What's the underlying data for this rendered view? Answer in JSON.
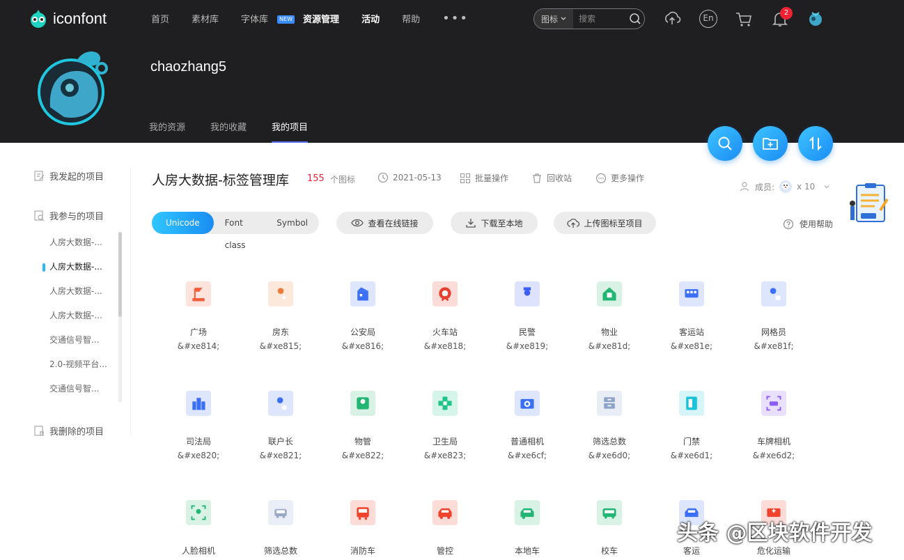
{
  "header": {
    "logo_text": "iconfont",
    "nav": [
      {
        "label": "首页",
        "bold": false
      },
      {
        "label": "素材库",
        "bold": false
      },
      {
        "label": "字体库",
        "bold": false,
        "badge": "NEW"
      },
      {
        "label": "资源管理",
        "bold": true
      },
      {
        "label": "活动",
        "bold": true
      },
      {
        "label": "帮助",
        "bold": false
      }
    ],
    "more": "•••",
    "search": {
      "scope": "图标",
      "placeholder": "搜索"
    },
    "icons": [
      "upload-icon",
      "language-en-icon",
      "cart-icon",
      "bell-icon",
      "user-avatar-icon"
    ],
    "lang_label": "En",
    "notification_count": "2"
  },
  "profile": {
    "username": "chaozhang5",
    "tabs": [
      {
        "label": "我的资源",
        "active": false
      },
      {
        "label": "我的收藏",
        "active": false
      },
      {
        "label": "我的项目",
        "active": true
      }
    ]
  },
  "sidebar": {
    "groups": [
      {
        "label": "我发起的项目",
        "icon": "edit-icon"
      },
      {
        "label": "我参与的项目",
        "icon": "search-doc-icon"
      },
      {
        "label": "我删除的项目",
        "icon": "trash-doc-icon"
      }
    ],
    "items": [
      {
        "label": "人房大数据-...",
        "active": false
      },
      {
        "label": "人房大数据-...",
        "active": true
      },
      {
        "label": "人房大数据-...",
        "active": false
      },
      {
        "label": "人房大数据-...",
        "active": false
      },
      {
        "label": "交通信号智...",
        "active": false
      },
      {
        "label": "2.0-视频平台...",
        "active": false
      },
      {
        "label": "交通信号智...",
        "active": false
      }
    ]
  },
  "project": {
    "title": "人房大数据-标签管理库",
    "count": "155",
    "count_label": "个图标",
    "date": "2021-05-13",
    "batch": "批量操作",
    "recycle": "回收站",
    "more": "更多操作",
    "members_label": "成员:",
    "members_count": "x 10",
    "help": "使用帮助",
    "formats": [
      {
        "label": "Unicode",
        "active": true
      },
      {
        "label": "Font class",
        "active": false
      },
      {
        "label": "Symbol",
        "active": false
      }
    ],
    "actions": {
      "view_link": "查看在线链接",
      "download": "下载至本地",
      "upload": "上传图标至项目"
    }
  },
  "icons": [
    {
      "name": "广场",
      "code": "&#xe814;",
      "color": "#f25c3b",
      "bg": "#fde3dc"
    },
    {
      "name": "房东",
      "code": "&#xe815;",
      "color": "#f07a3a",
      "bg": "#fde8dc"
    },
    {
      "name": "公安局",
      "code": "&#xe816;",
      "color": "#3b6ff5",
      "bg": "#dde6fd"
    },
    {
      "name": "火车站",
      "code": "&#xe818;",
      "color": "#e8402e",
      "bg": "#fbdcd8"
    },
    {
      "name": "民警",
      "code": "&#xe819;",
      "color": "#3b5ef5",
      "bg": "#dde3fd"
    },
    {
      "name": "物业",
      "code": "&#xe81d;",
      "color": "#22b573",
      "bg": "#d8f3e5"
    },
    {
      "name": "客运站",
      "code": "&#xe81e;",
      "color": "#3b6ff5",
      "bg": "#dde6fd"
    },
    {
      "name": "网格员",
      "code": "&#xe81f;",
      "color": "#3b6ff5",
      "bg": "#dde6fd"
    },
    {
      "name": "司法局",
      "code": "&#xe820;",
      "color": "#3b6ff5",
      "bg": "#dde6fd"
    },
    {
      "name": "联户长",
      "code": "&#xe821;",
      "color": "#3b6ff5",
      "bg": "#dde6fd"
    },
    {
      "name": "物管",
      "code": "&#xe822;",
      "color": "#22b573",
      "bg": "#d8f3e5"
    },
    {
      "name": "卫生局",
      "code": "&#xe823;",
      "color": "#1fc48a",
      "bg": "#d6f5ea"
    },
    {
      "name": "普通相机",
      "code": "&#xe6cf;",
      "color": "#3b6ff5",
      "bg": "#dde6fd"
    },
    {
      "name": "筛选总数",
      "code": "&#xe6d0;",
      "color": "#8da3c8",
      "bg": "#e8edf6"
    },
    {
      "name": "门禁",
      "code": "&#xe6d1;",
      "color": "#1cc3d8",
      "bg": "#d5f5f9"
    },
    {
      "name": "车牌相机",
      "code": "&#xe6d2;",
      "color": "#8a5cf5",
      "bg": "#e9e0fd"
    },
    {
      "name": "人脸相机",
      "code": "",
      "color": "#22b573",
      "bg": "#d8f3e5"
    },
    {
      "name": "筛选总数",
      "code": "",
      "color": "#9aa9c8",
      "bg": "#eaeef6"
    },
    {
      "name": "消防车",
      "code": "",
      "color": "#f0432e",
      "bg": "#fddcd8"
    },
    {
      "name": "管控",
      "code": "",
      "color": "#f0432e",
      "bg": "#fddcd8"
    },
    {
      "name": "本地车",
      "code": "",
      "color": "#22b573",
      "bg": "#d8f3e5"
    },
    {
      "name": "校车",
      "code": "",
      "color": "#22b573",
      "bg": "#d8f3e5"
    },
    {
      "name": "客运",
      "code": "",
      "color": "#3b6ff5",
      "bg": "#dde6fd"
    },
    {
      "name": "危化运输",
      "code": "",
      "color": "#f0432e",
      "bg": "#fddcd8"
    }
  ],
  "watermark": "头条 @区块软件开发",
  "colors": {
    "accent": "#2cb7f5",
    "header_bg": "#1f1f21",
    "count_red": "#e23"
  }
}
